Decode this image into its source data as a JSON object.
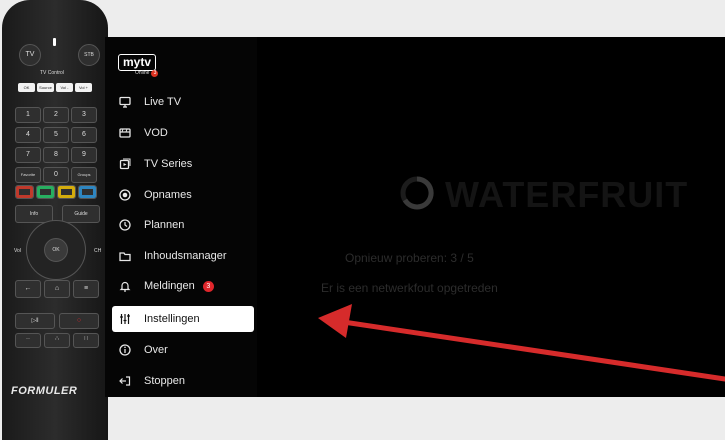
{
  "remote": {
    "tv_label": "TV",
    "stb_label": "STB",
    "tv_control_label": "TV Control",
    "top_buttons": [
      "OK",
      "Source",
      "Vol -",
      "Vol +"
    ],
    "digits": [
      "1",
      "2",
      "3",
      "4",
      "5",
      "6",
      "7",
      "8",
      "9"
    ],
    "zero": "0",
    "favorite_label": "Favorite",
    "groups_label": "Groups",
    "color_keys": [
      "#c0392b",
      "#27ae60",
      "#d4ac0d",
      "#2e86c1"
    ],
    "info_label": "Info",
    "guide_label": "Guide",
    "vol_label": "Vol",
    "ok_label": "OK",
    "ch_label": "CH",
    "brand": "FORMULER"
  },
  "app": {
    "logo": "mytv",
    "logo_sub": "Online",
    "logo_badge": "3"
  },
  "menu": {
    "items": [
      {
        "label": "Live TV",
        "icon": "tv-icon"
      },
      {
        "label": "VOD",
        "icon": "film-icon"
      },
      {
        "label": "TV Series",
        "icon": "series-icon"
      },
      {
        "label": "Opnames",
        "icon": "record-icon"
      },
      {
        "label": "Plannen",
        "icon": "clock-icon"
      },
      {
        "label": "Inhoudsmanager",
        "icon": "folder-icon"
      },
      {
        "label": "Meldingen",
        "icon": "bell-icon",
        "badge": "3"
      },
      {
        "label": "Instellingen",
        "icon": "sliders-icon",
        "selected": true
      },
      {
        "label": "Over",
        "icon": "info-icon"
      },
      {
        "label": "Stoppen",
        "icon": "exit-icon"
      }
    ]
  },
  "content": {
    "watermark": "WATERFRUIT",
    "retry_text": "Opnieuw proberen: 3 / 5",
    "error_text": "Er is een netwerkfout opgetreden"
  },
  "colors": {
    "arrow": "#d62b2b",
    "badge": "#e0262b"
  }
}
